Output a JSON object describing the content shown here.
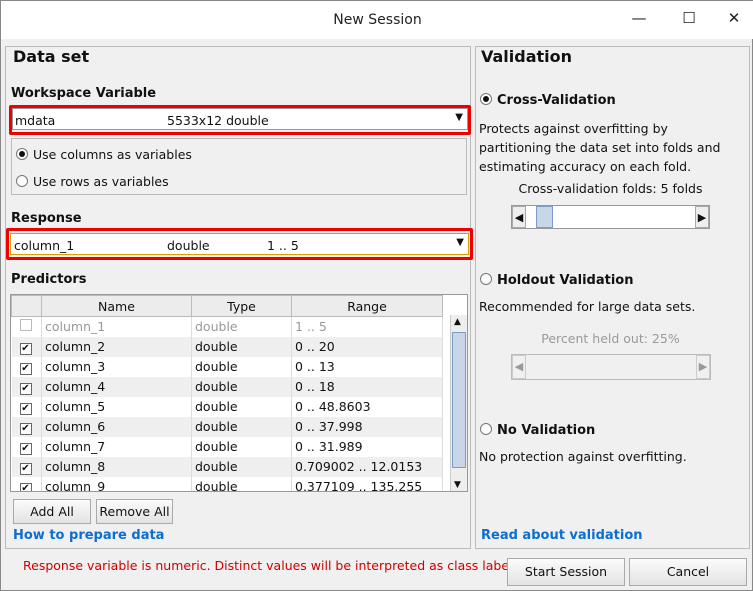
{
  "window": {
    "title": "New Session",
    "minimize": "—",
    "maximize": "☐",
    "close": "✕"
  },
  "dataset": {
    "heading": "Data set",
    "workspace_label": "Workspace Variable",
    "workspace_var": {
      "name": "mdata",
      "info": "5533x12 double"
    },
    "orientation": {
      "columns": "Use columns as variables",
      "rows": "Use rows as variables",
      "selected": "columns"
    },
    "response_label": "Response",
    "response": {
      "name": "column_1",
      "type": "double",
      "range": "1 .. 5"
    },
    "predictors_label": "Predictors",
    "columns": [
      "Name",
      "Type",
      "Range"
    ],
    "rows": [
      {
        "name": "column_1",
        "type": "double",
        "range": "1 .. 5",
        "checked": false,
        "disabled": true
      },
      {
        "name": "column_2",
        "type": "double",
        "range": "0 .. 20",
        "checked": true
      },
      {
        "name": "column_3",
        "type": "double",
        "range": "0 .. 13",
        "checked": true
      },
      {
        "name": "column_4",
        "type": "double",
        "range": "0 .. 18",
        "checked": true
      },
      {
        "name": "column_5",
        "type": "double",
        "range": "0 .. 48.8603",
        "checked": true
      },
      {
        "name": "column_6",
        "type": "double",
        "range": "0 .. 37.998",
        "checked": true
      },
      {
        "name": "column_7",
        "type": "double",
        "range": "0 .. 31.989",
        "checked": true
      },
      {
        "name": "column_8",
        "type": "double",
        "range": "0.709002 .. 12.0153",
        "checked": true
      },
      {
        "name": "column_9",
        "type": "double",
        "range": "0.377109 .. 135.255",
        "checked": true
      }
    ],
    "add_all": "Add All",
    "remove_all": "Remove All",
    "help_link": "How to prepare data"
  },
  "validation": {
    "heading": "Validation",
    "cv": {
      "label": "Cross-Validation",
      "desc": "Protects against overfitting by partitioning the data set into folds and estimating accuracy on each fold.",
      "folds_label": "Cross-validation folds: 5 folds",
      "folds": 5
    },
    "holdout": {
      "label": "Holdout Validation",
      "desc": "Recommended for large data sets.",
      "percent_label": "Percent held out: 25%",
      "percent": 25
    },
    "none": {
      "label": "No Validation",
      "desc": "No protection against overfitting."
    },
    "selected": "cv",
    "help_link": "Read about validation"
  },
  "footer": {
    "message": "Response variable is numeric. Distinct values will be interpreted as class labels.",
    "message_color": "#cc0000",
    "start": "Start Session",
    "cancel": "Cancel"
  }
}
